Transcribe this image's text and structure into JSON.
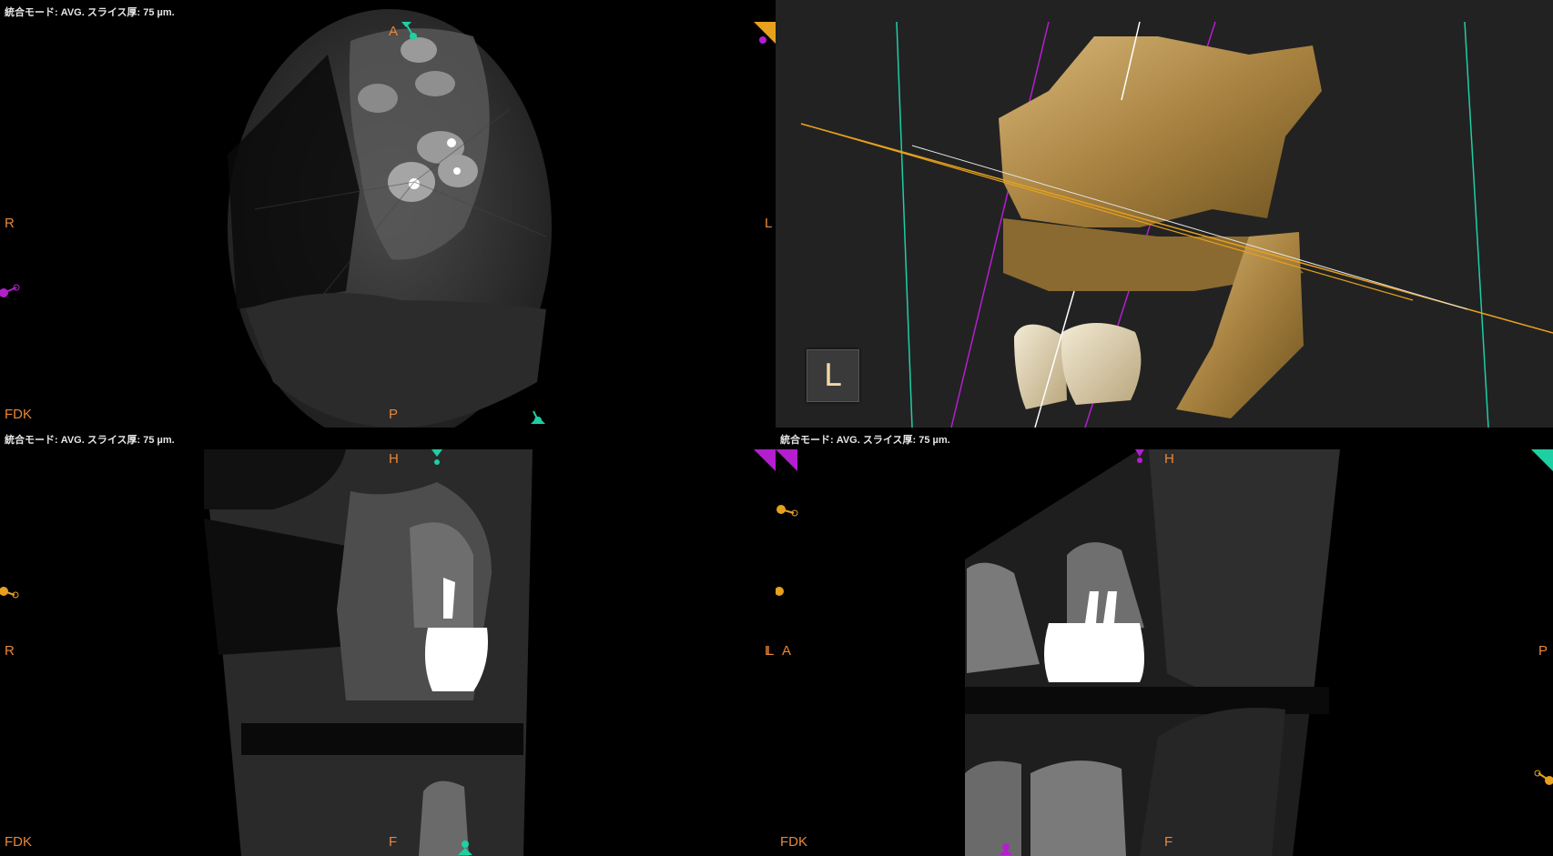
{
  "viewports": {
    "axial": {
      "header": "統合モード: AVG. スライス厚: 75 µm.",
      "top_label": "A",
      "bottom_label": "P",
      "left_label": "R",
      "right_label": "L",
      "recon_label": "FDK"
    },
    "volume3d": {
      "orientation_badge": "L"
    },
    "coronal": {
      "header": "統合モード: AVG. スライス厚: 75 µm.",
      "top_label": "H",
      "bottom_label": "F",
      "left_label": "R",
      "right_label": "L",
      "recon_label": "FDK"
    },
    "sagittal": {
      "header": "統合モード: AVG. スライス厚: 75 µm.",
      "top_label": "H",
      "bottom_label": "F",
      "left_label": "A",
      "right_label": "P",
      "recon_label": "FDK"
    }
  },
  "colors": {
    "axis_cyan": "#1ecfa4",
    "axis_purple": "#b41ecf",
    "axis_yellow": "#e6a11e",
    "label_orange": "#e8873a"
  },
  "icons": {
    "crosshair_handle": "crosshair-handle-icon",
    "corner_marker": "corner-triangle-icon"
  }
}
